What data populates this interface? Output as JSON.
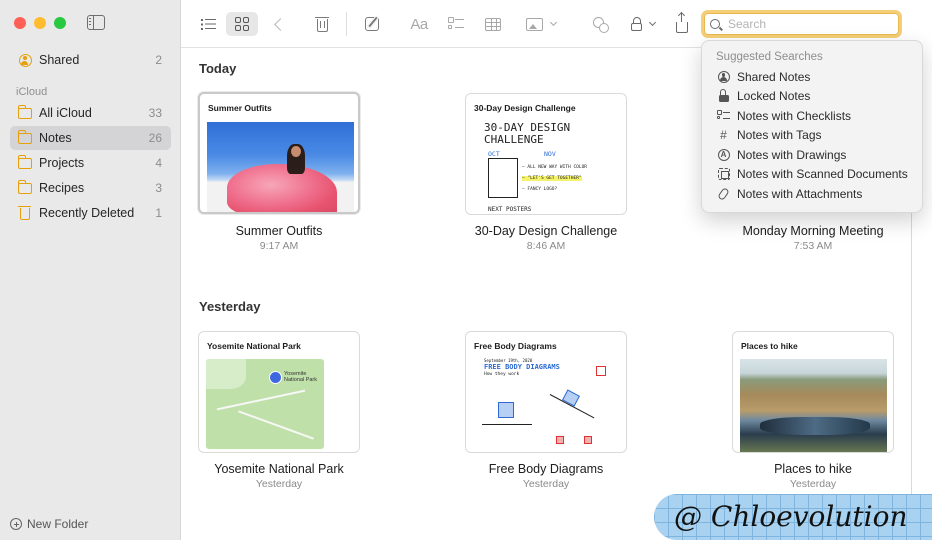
{
  "sidebar": {
    "items": [
      {
        "label": "Shared",
        "count": "2",
        "icon": "shared-icon"
      },
      {
        "label": "All iCloud",
        "count": "33",
        "icon": "folder-icon"
      },
      {
        "label": "Notes",
        "count": "26",
        "icon": "folder-icon",
        "selected": true
      },
      {
        "label": "Projects",
        "count": "4",
        "icon": "folder-icon"
      },
      {
        "label": "Recipes",
        "count": "3",
        "icon": "folder-icon"
      },
      {
        "label": "Recently Deleted",
        "count": "1",
        "icon": "trash-icon"
      }
    ],
    "section_label": "iCloud",
    "new_folder_label": "New Folder"
  },
  "toolbar": {
    "search_placeholder": "Search",
    "format_label": "Aa"
  },
  "dropdown": {
    "title": "Suggested Searches",
    "items": [
      {
        "label": "Shared Notes",
        "icon": "person-circle-icon"
      },
      {
        "label": "Locked Notes",
        "icon": "lock-icon"
      },
      {
        "label": "Notes with Checklists",
        "icon": "checklist-icon"
      },
      {
        "label": "Notes with Tags",
        "icon": "hashtag-icon"
      },
      {
        "label": "Notes with Drawings",
        "icon": "drawing-icon"
      },
      {
        "label": "Notes with Scanned Documents",
        "icon": "scan-icon"
      },
      {
        "label": "Notes with Attachments",
        "icon": "paperclip-icon"
      }
    ]
  },
  "sections": {
    "today": "Today",
    "yesterday": "Yesterday"
  },
  "notes": {
    "today": [
      {
        "title": "Summer Outfits",
        "time": "9:17 AM",
        "preview_heading": "Summer Outfits"
      },
      {
        "title": "30-Day Design Challenge",
        "time": "8:46 AM",
        "preview_heading": "30-Day Design Challenge"
      },
      {
        "title": "Monday Morning Meeting",
        "time": "7:53 AM"
      }
    ],
    "yesterday": [
      {
        "title": "Yosemite National Park",
        "time": "Yesterday",
        "preview_heading": "Yosemite National Park"
      },
      {
        "title": "Free Body Diagrams",
        "time": "Yesterday",
        "preview_heading": "Free Body Diagrams"
      },
      {
        "title": "Places to hike",
        "time": "Yesterday",
        "preview_heading": "Places to hike"
      }
    ]
  },
  "previews": {
    "design_big": "30-DAY DESIGN CHALLENGE",
    "design_oct": "OCT",
    "design_nov": "NOV",
    "design_line1": "— ALL NEW WAY WITH COLOR",
    "design_line2": "— \"LET'S GET TOGETHER\"",
    "design_line3": "— FANCY LOGO?",
    "design_footer": "NEXT POSTERS",
    "map_pin_label": "Yosemite National Park",
    "physics_date": "September 19th, 2020",
    "physics_big": "FREE BODY DIAGRAMS",
    "physics_sub": "How they work"
  },
  "watermark": "@ Chloevolution"
}
